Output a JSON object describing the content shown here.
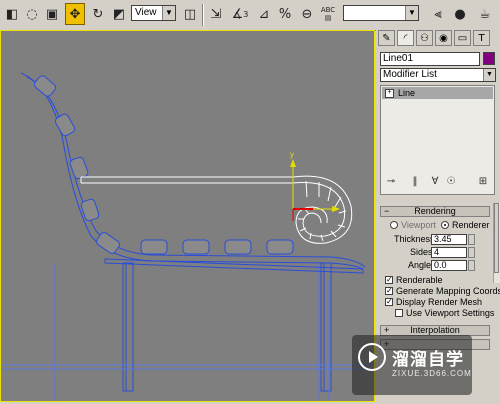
{
  "toolbar": {
    "view_dropdown": "View",
    "selection_set": "",
    "abc_label": "ABC",
    "angle_snap_label": "3"
  },
  "command_panel": {
    "object_name": "Line01",
    "object_color": "#800080",
    "modifier_list_label": "Modifier List",
    "stack_item": "Line",
    "rendering": {
      "title": "Rendering",
      "viewport_label": "Viewport",
      "renderer_label": "Renderer",
      "thickness_label": "Thickness:",
      "thickness_value": "3.45",
      "sides_label": "Sides:",
      "sides_value": "4",
      "angle_label": "Angle:",
      "angle_value": "0.0",
      "renderable_label": "Renderable",
      "mapping_label": "Generate Mapping Coords.",
      "display_mesh_label": "Display Render Mesh",
      "use_viewport_label": "Use Viewport Settings"
    },
    "interpolation_title": "Interpolation"
  },
  "watermark": {
    "brand": "溜溜自学",
    "url": "ZIXUE.3D66.COM"
  },
  "colors": {
    "viewport_bg": "#7f7f7f",
    "viewport_border": "#f0e000",
    "wire": "#2a4dd8",
    "selected_wire": "#ffffff",
    "active_tool": "#f0c000"
  }
}
